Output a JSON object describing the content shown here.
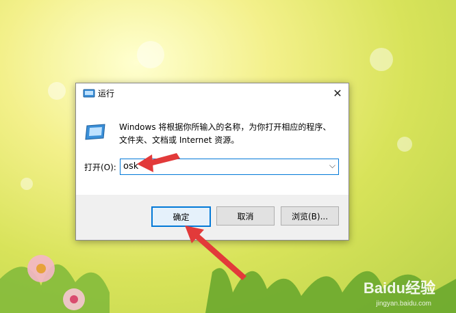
{
  "window": {
    "title": "运行",
    "close_glyph": "✕"
  },
  "content": {
    "description": "Windows 将根据你所输入的名称，为你打开相应的程序、文件夹、文档或 Internet 资源。",
    "open_label": "打开(O):",
    "input_value": "osk",
    "dropdown_glyph": "⌵"
  },
  "buttons": {
    "ok": "确定",
    "cancel": "取消",
    "browse": "浏览(B)..."
  },
  "watermark": {
    "brand": "Baidu经验",
    "url": "jingyan.baidu.com"
  },
  "colors": {
    "accent": "#0078d7",
    "annotation_arrow": "#e23a3a"
  }
}
